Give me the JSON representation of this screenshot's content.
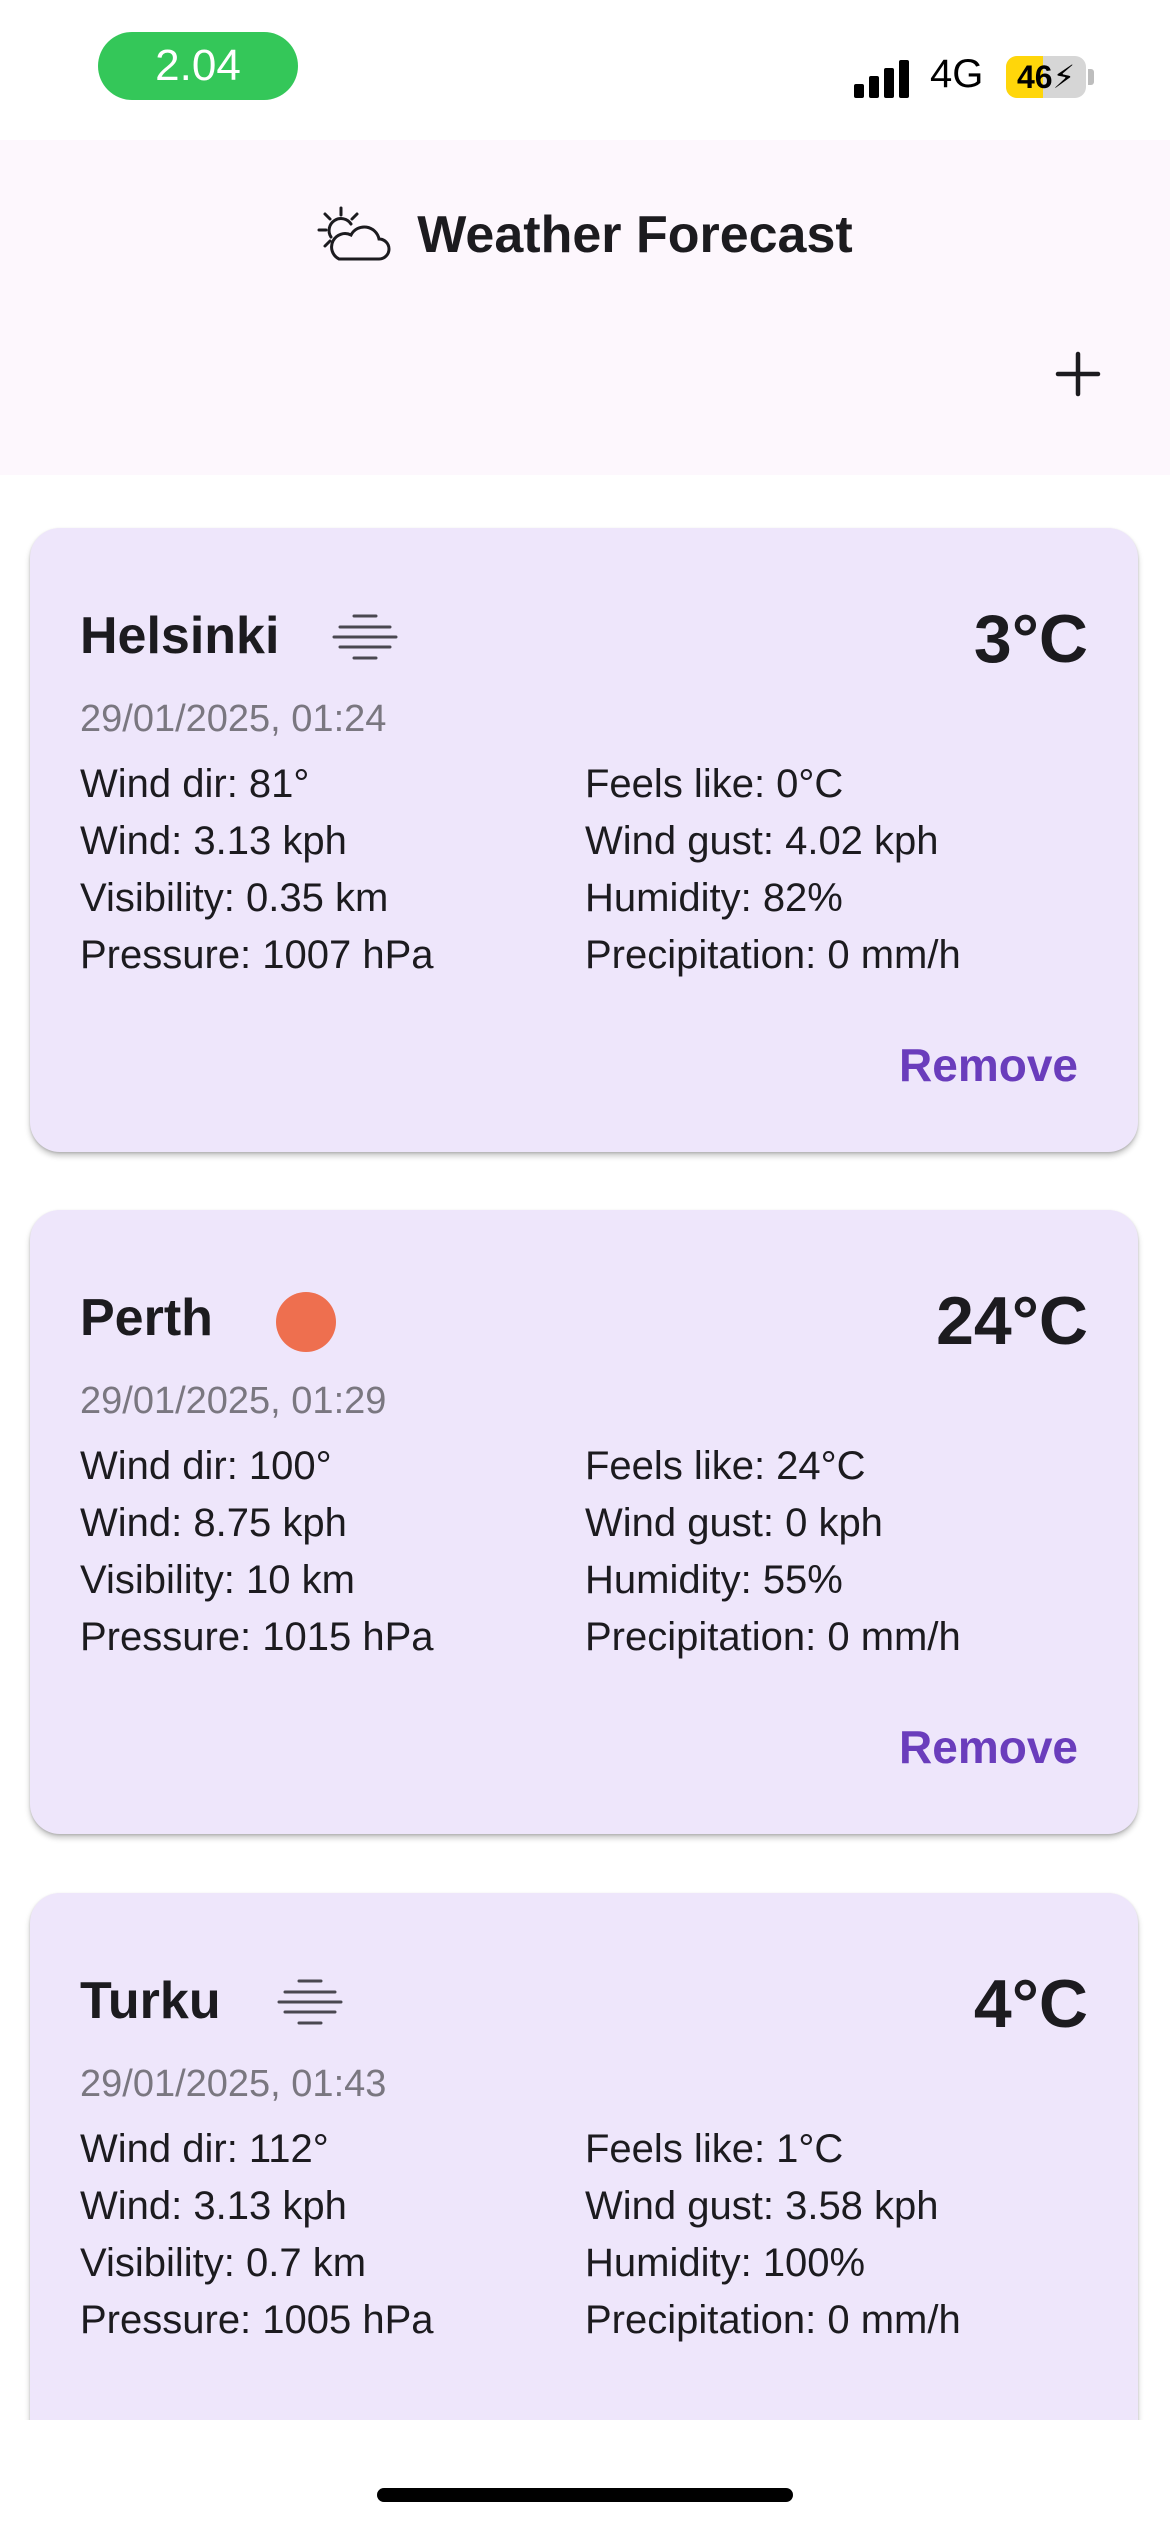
{
  "status_bar": {
    "time": "2.04",
    "network": "4G",
    "battery": "46",
    "battery_level": 0.46,
    "colors": {
      "time_pill": "#34c759",
      "battery_fill": "#ffd60a"
    }
  },
  "header": {
    "title": "Weather Forecast",
    "icon": "sun-behind-cloud-icon",
    "add_icon": "plus-icon",
    "background": "#fdf7fd"
  },
  "cards": [
    {
      "city": "Helsinki",
      "condition_icon": "fog-icon",
      "temp": "3°C",
      "time": "29/01/2025, 01:24",
      "wind_dir": "Wind dir: 81°",
      "wind": "Wind: 3.13 kph",
      "visibility": "Visibility: 0.35 km",
      "pressure": "Pressure: 1007 hPa",
      "feels_like": "Feels like: 0°C",
      "wind_gust": "Wind gust: 4.02 kph",
      "humidity": "Humidity: 82%",
      "precipitation": "Precipitation: 0 mm/h",
      "remove_label": "Remove"
    },
    {
      "city": "Perth",
      "condition_icon": "sun-icon",
      "temp": "24°C",
      "time": "29/01/2025, 01:29",
      "wind_dir": "Wind dir: 100°",
      "wind": "Wind: 8.75 kph",
      "visibility": "Visibility: 10 km",
      "pressure": "Pressure: 1015 hPa",
      "feels_like": "Feels like: 24°C",
      "wind_gust": "Wind gust: 0 kph",
      "humidity": "Humidity: 55%",
      "precipitation": "Precipitation: 0 mm/h",
      "remove_label": "Remove"
    },
    {
      "city": "Turku",
      "condition_icon": "fog-icon",
      "temp": "4°C",
      "time": "29/01/2025, 01:43",
      "wind_dir": "Wind dir: 112°",
      "wind": "Wind: 3.13 kph",
      "visibility": "Visibility: 0.7 km",
      "pressure": "Pressure: 1005 hPa",
      "feels_like": "Feels like: 1°C",
      "wind_gust": "Wind gust: 3.58 kph",
      "humidity": "Humidity: 100%",
      "precipitation": "Precipitation: 0 mm/h"
    }
  ],
  "colors": {
    "card_background": "#eee6fb",
    "accent": "#6a3dbc",
    "sun": "#ee6f4f"
  }
}
